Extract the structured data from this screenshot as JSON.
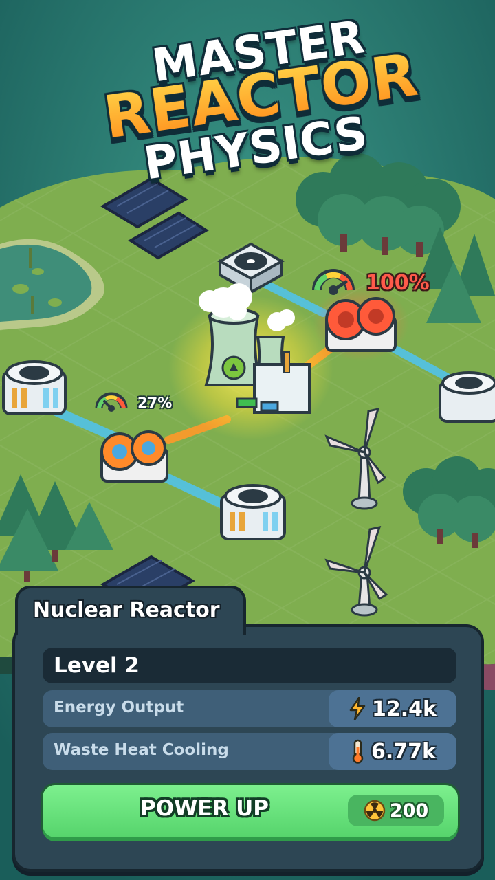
{
  "title": {
    "line1": "MASTER",
    "line2": "REACTOR",
    "line3": "PHYSICS"
  },
  "map": {
    "generator_big": {
      "output_label": "100%",
      "gauge_level": 1.0
    },
    "generator_small": {
      "output_label": "27%",
      "gauge_level": 0.27
    }
  },
  "panel": {
    "title": "Nuclear Reactor",
    "level": "Level 2",
    "stats": [
      {
        "label": "Energy Output",
        "value": "12.4k",
        "icon": "lightning-icon"
      },
      {
        "label": "Waste Heat Cooling",
        "value": "6.77k",
        "icon": "thermometer-icon"
      }
    ],
    "button": {
      "label": "POWER UP",
      "cost": "200",
      "cost_icon": "radiation-coin-icon"
    }
  },
  "colors": {
    "accent_orange": "#ffa21e",
    "button_green": "#6ee883",
    "panel_bg": "#2d4654",
    "hot_red": "#ff5a4a"
  }
}
